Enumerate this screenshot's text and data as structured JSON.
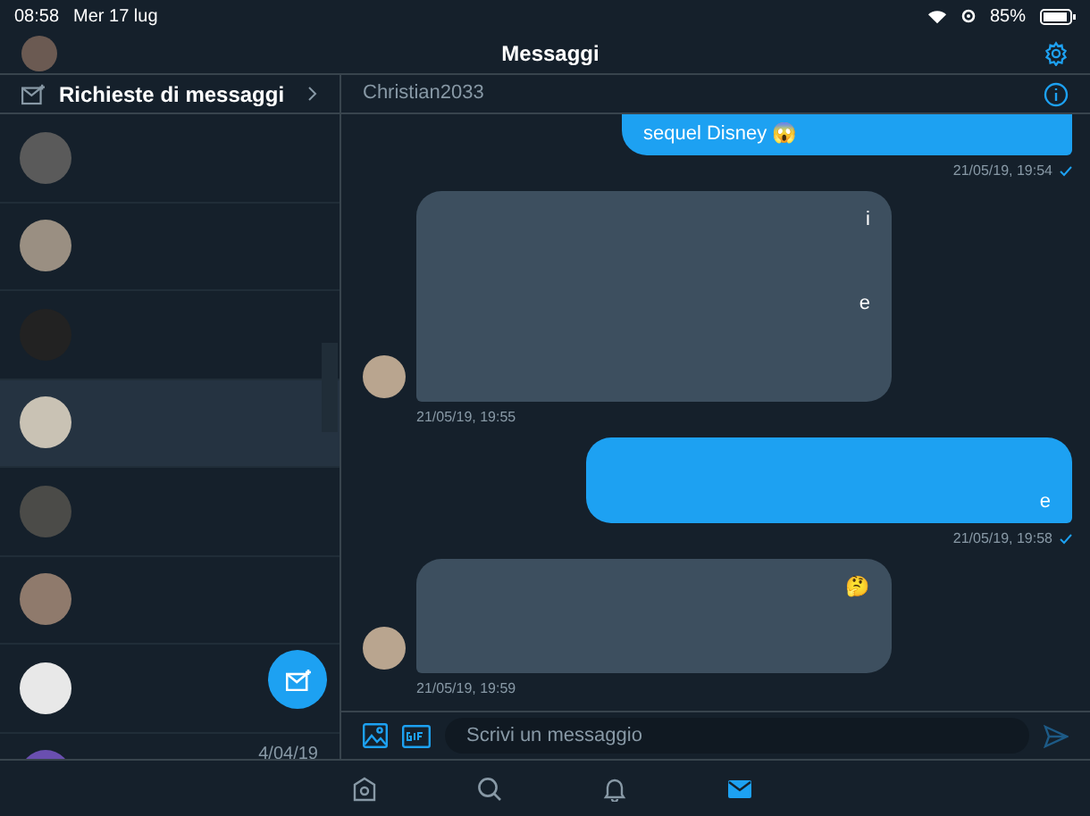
{
  "status_bar": {
    "time": "08:58",
    "date": "Mer 17 lug",
    "battery": "85%"
  },
  "header": {
    "title": "Messaggi"
  },
  "requests": {
    "label": "Richieste di messaggi"
  },
  "conversations": [
    {
      "selected": false
    },
    {
      "selected": false
    },
    {
      "selected": false
    },
    {
      "selected": true
    },
    {
      "selected": false
    },
    {
      "selected": false
    },
    {
      "selected": false
    },
    {
      "selected": false,
      "date": "4/04/19"
    }
  ],
  "chat": {
    "title": "Christian2033",
    "composer": {
      "placeholder": "Scrivi un messaggio"
    },
    "messages": [
      {
        "kind": "outgoing",
        "text": "sequel Disney 😱",
        "time": "21/05/19, 19:54",
        "read": true
      },
      {
        "kind": "incoming",
        "fragments": [
          "i",
          "e"
        ],
        "time": "21/05/19, 19:55"
      },
      {
        "kind": "outgoing",
        "text": "e",
        "time": "21/05/19, 19:58",
        "read": true
      },
      {
        "kind": "incoming",
        "fragments": [
          "🤔"
        ],
        "time": "21/05/19, 19:59"
      }
    ]
  },
  "tabs": [
    {
      "kind": "home",
      "selected": false
    },
    {
      "kind": "search",
      "selected": false
    },
    {
      "kind": "notifications",
      "selected": false
    },
    {
      "kind": "messages",
      "selected": true
    }
  ]
}
